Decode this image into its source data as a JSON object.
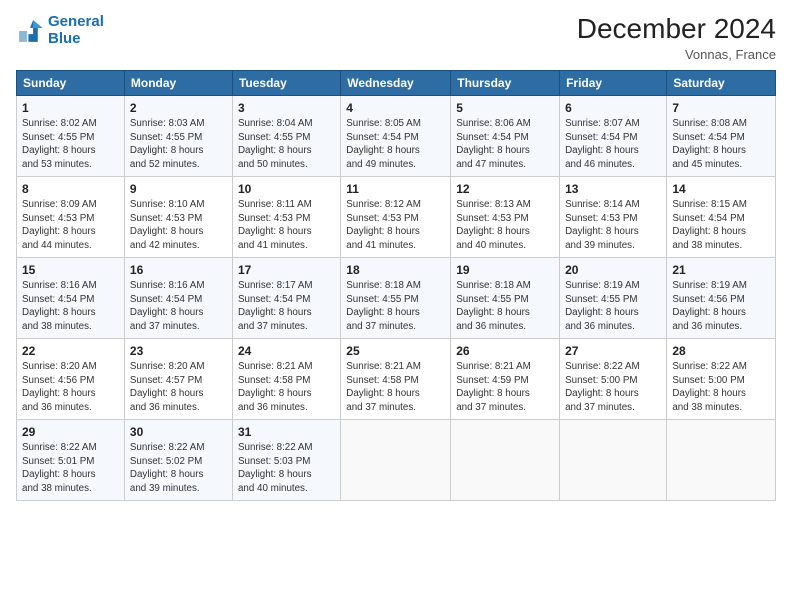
{
  "logo": {
    "line1": "General",
    "line2": "Blue"
  },
  "header": {
    "title": "December 2024",
    "location": "Vonnas, France"
  },
  "weekdays": [
    "Sunday",
    "Monday",
    "Tuesday",
    "Wednesday",
    "Thursday",
    "Friday",
    "Saturday"
  ],
  "weeks": [
    [
      {
        "day": "1",
        "sunrise": "8:02 AM",
        "sunset": "4:55 PM",
        "daylight": "8 hours and 53 minutes."
      },
      {
        "day": "2",
        "sunrise": "8:03 AM",
        "sunset": "4:55 PM",
        "daylight": "8 hours and 52 minutes."
      },
      {
        "day": "3",
        "sunrise": "8:04 AM",
        "sunset": "4:55 PM",
        "daylight": "8 hours and 50 minutes."
      },
      {
        "day": "4",
        "sunrise": "8:05 AM",
        "sunset": "4:54 PM",
        "daylight": "8 hours and 49 minutes."
      },
      {
        "day": "5",
        "sunrise": "8:06 AM",
        "sunset": "4:54 PM",
        "daylight": "8 hours and 47 minutes."
      },
      {
        "day": "6",
        "sunrise": "8:07 AM",
        "sunset": "4:54 PM",
        "daylight": "8 hours and 46 minutes."
      },
      {
        "day": "7",
        "sunrise": "8:08 AM",
        "sunset": "4:54 PM",
        "daylight": "8 hours and 45 minutes."
      }
    ],
    [
      {
        "day": "8",
        "sunrise": "8:09 AM",
        "sunset": "4:53 PM",
        "daylight": "8 hours and 44 minutes."
      },
      {
        "day": "9",
        "sunrise": "8:10 AM",
        "sunset": "4:53 PM",
        "daylight": "8 hours and 42 minutes."
      },
      {
        "day": "10",
        "sunrise": "8:11 AM",
        "sunset": "4:53 PM",
        "daylight": "8 hours and 41 minutes."
      },
      {
        "day": "11",
        "sunrise": "8:12 AM",
        "sunset": "4:53 PM",
        "daylight": "8 hours and 41 minutes."
      },
      {
        "day": "12",
        "sunrise": "8:13 AM",
        "sunset": "4:53 PM",
        "daylight": "8 hours and 40 minutes."
      },
      {
        "day": "13",
        "sunrise": "8:14 AM",
        "sunset": "4:53 PM",
        "daylight": "8 hours and 39 minutes."
      },
      {
        "day": "14",
        "sunrise": "8:15 AM",
        "sunset": "4:54 PM",
        "daylight": "8 hours and 38 minutes."
      }
    ],
    [
      {
        "day": "15",
        "sunrise": "8:16 AM",
        "sunset": "4:54 PM",
        "daylight": "8 hours and 38 minutes."
      },
      {
        "day": "16",
        "sunrise": "8:16 AM",
        "sunset": "4:54 PM",
        "daylight": "8 hours and 37 minutes."
      },
      {
        "day": "17",
        "sunrise": "8:17 AM",
        "sunset": "4:54 PM",
        "daylight": "8 hours and 37 minutes."
      },
      {
        "day": "18",
        "sunrise": "8:18 AM",
        "sunset": "4:55 PM",
        "daylight": "8 hours and 37 minutes."
      },
      {
        "day": "19",
        "sunrise": "8:18 AM",
        "sunset": "4:55 PM",
        "daylight": "8 hours and 36 minutes."
      },
      {
        "day": "20",
        "sunrise": "8:19 AM",
        "sunset": "4:55 PM",
        "daylight": "8 hours and 36 minutes."
      },
      {
        "day": "21",
        "sunrise": "8:19 AM",
        "sunset": "4:56 PM",
        "daylight": "8 hours and 36 minutes."
      }
    ],
    [
      {
        "day": "22",
        "sunrise": "8:20 AM",
        "sunset": "4:56 PM",
        "daylight": "8 hours and 36 minutes."
      },
      {
        "day": "23",
        "sunrise": "8:20 AM",
        "sunset": "4:57 PM",
        "daylight": "8 hours and 36 minutes."
      },
      {
        "day": "24",
        "sunrise": "8:21 AM",
        "sunset": "4:58 PM",
        "daylight": "8 hours and 36 minutes."
      },
      {
        "day": "25",
        "sunrise": "8:21 AM",
        "sunset": "4:58 PM",
        "daylight": "8 hours and 37 minutes."
      },
      {
        "day": "26",
        "sunrise": "8:21 AM",
        "sunset": "4:59 PM",
        "daylight": "8 hours and 37 minutes."
      },
      {
        "day": "27",
        "sunrise": "8:22 AM",
        "sunset": "5:00 PM",
        "daylight": "8 hours and 37 minutes."
      },
      {
        "day": "28",
        "sunrise": "8:22 AM",
        "sunset": "5:00 PM",
        "daylight": "8 hours and 38 minutes."
      }
    ],
    [
      {
        "day": "29",
        "sunrise": "8:22 AM",
        "sunset": "5:01 PM",
        "daylight": "8 hours and 38 minutes."
      },
      {
        "day": "30",
        "sunrise": "8:22 AM",
        "sunset": "5:02 PM",
        "daylight": "8 hours and 39 minutes."
      },
      {
        "day": "31",
        "sunrise": "8:22 AM",
        "sunset": "5:03 PM",
        "daylight": "8 hours and 40 minutes."
      },
      null,
      null,
      null,
      null
    ]
  ],
  "labels": {
    "sunrise": "Sunrise:",
    "sunset": "Sunset:",
    "daylight": "Daylight:"
  }
}
